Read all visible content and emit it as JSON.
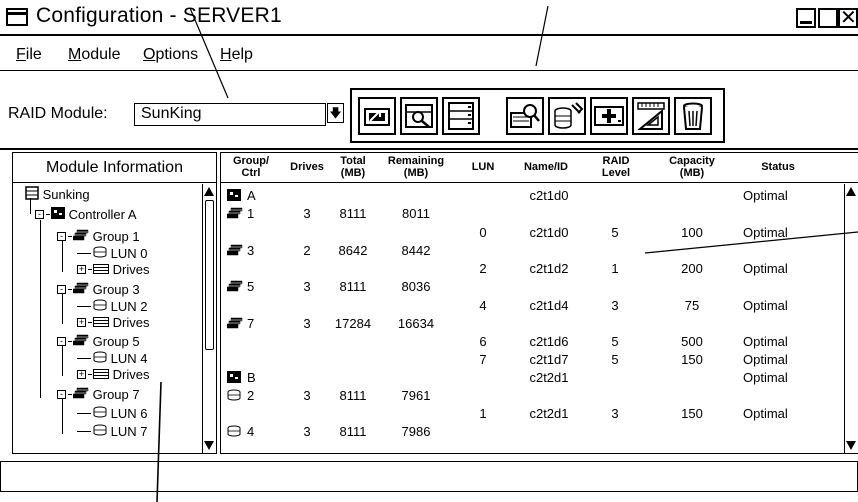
{
  "window": {
    "title": "Configuration - SERVER1"
  },
  "menu": [
    {
      "label": "File",
      "accel": "F",
      "rest": "ile"
    },
    {
      "label": "Module",
      "accel": "M",
      "rest": "odule"
    },
    {
      "label": "Options",
      "accel": "O",
      "rest": "ptions"
    },
    {
      "label": "Help",
      "accel": "H",
      "rest": "elp"
    }
  ],
  "toolbar": {
    "raid_label": "RAID Module:",
    "raid_value": "SunKing",
    "tools": [
      "create-lun-icon",
      "find-locate-icon",
      "module-profile-icon",
      "view-log-icon",
      "recovery-icon",
      "add-icon",
      "format-icon",
      "delete-trash-icon"
    ]
  },
  "left_panel": {
    "header": "Module Information",
    "tree": [
      {
        "label": "Sunking",
        "icon": "module-icon"
      },
      {
        "label": "Controller A",
        "icon": "controller-icon"
      },
      {
        "label": "Group 1",
        "icon": "group-icon"
      },
      {
        "label": "LUN 0",
        "icon": "lun-icon"
      },
      {
        "label": "Drives",
        "icon": "drives-icon"
      },
      {
        "label": "Group 3",
        "icon": "group-icon"
      },
      {
        "label": "LUN 2",
        "icon": "lun-icon"
      },
      {
        "label": "Drives",
        "icon": "drives-icon"
      },
      {
        "label": "Group 5",
        "icon": "group-icon"
      },
      {
        "label": "LUN 4",
        "icon": "lun-icon"
      },
      {
        "label": "Drives",
        "icon": "drives-icon"
      },
      {
        "label": "Group 7",
        "icon": "group-icon"
      },
      {
        "label": "LUN 6",
        "icon": "lun-icon"
      },
      {
        "label": "LUN 7",
        "icon": "lun-icon"
      }
    ]
  },
  "grid": {
    "headers": {
      "group_ctrl": [
        "Group/",
        "Ctrl"
      ],
      "drives": "Drives",
      "total": [
        "Total",
        "(MB)"
      ],
      "remaining": [
        "Remaining",
        "(MB)"
      ],
      "lun": "LUN",
      "name": "Name/ID",
      "raid": [
        "RAID",
        "Level"
      ],
      "capacity": [
        "Capacity",
        "(MB)"
      ],
      "status": "Status"
    },
    "rows": [
      {
        "icon": "controller-icon",
        "group": "A",
        "drives": "",
        "total": "",
        "remaining": "",
        "lun": "",
        "name": "c2t1d0",
        "raid": "",
        "capacity": "",
        "status": "Optimal"
      },
      {
        "icon": "group-icon",
        "group": "1",
        "drives": "3",
        "total": "8111",
        "remaining": "8011",
        "lun": "",
        "name": "",
        "raid": "",
        "capacity": "",
        "status": ""
      },
      {
        "icon": "",
        "group": "",
        "drives": "",
        "total": "",
        "remaining": "",
        "lun": "0",
        "name": "c2t1d0",
        "raid": "5",
        "capacity": "100",
        "status": "Optimal"
      },
      {
        "icon": "group-icon",
        "group": "3",
        "drives": "2",
        "total": "8642",
        "remaining": "8442",
        "lun": "",
        "name": "",
        "raid": "",
        "capacity": "",
        "status": ""
      },
      {
        "icon": "",
        "group": "",
        "drives": "",
        "total": "",
        "remaining": "",
        "lun": "2",
        "name": "c2t1d2",
        "raid": "1",
        "capacity": "200",
        "status": "Optimal"
      },
      {
        "icon": "group-icon",
        "group": "5",
        "drives": "3",
        "total": "8111",
        "remaining": "8036",
        "lun": "",
        "name": "",
        "raid": "",
        "capacity": "",
        "status": ""
      },
      {
        "icon": "",
        "group": "",
        "drives": "",
        "total": "",
        "remaining": "",
        "lun": "4",
        "name": "c2t1d4",
        "raid": "3",
        "capacity": "75",
        "status": "Optimal"
      },
      {
        "icon": "group-icon",
        "group": "7",
        "drives": "3",
        "total": "17284",
        "remaining": "16634",
        "lun": "",
        "name": "",
        "raid": "",
        "capacity": "",
        "status": ""
      },
      {
        "icon": "",
        "group": "",
        "drives": "",
        "total": "",
        "remaining": "",
        "lun": "6",
        "name": "c2t1d6",
        "raid": "5",
        "capacity": "500",
        "status": "Optimal"
      },
      {
        "icon": "",
        "group": "",
        "drives": "",
        "total": "",
        "remaining": "",
        "lun": "7",
        "name": "c2t1d7",
        "raid": "5",
        "capacity": "150",
        "status": "Optimal"
      },
      {
        "icon": "controller-icon",
        "group": "B",
        "drives": "",
        "total": "",
        "remaining": "",
        "lun": "",
        "name": "c2t2d1",
        "raid": "",
        "capacity": "",
        "status": "Optimal"
      },
      {
        "icon": "disk-icon",
        "group": "2",
        "drives": "3",
        "total": "8111",
        "remaining": "7961",
        "lun": "",
        "name": "",
        "raid": "",
        "capacity": "",
        "status": ""
      },
      {
        "icon": "",
        "group": "",
        "drives": "",
        "total": "",
        "remaining": "",
        "lun": "1",
        "name": "c2t2d1",
        "raid": "3",
        "capacity": "150",
        "status": "Optimal"
      },
      {
        "icon": "disk-icon",
        "group": "4",
        "drives": "3",
        "total": "8111",
        "remaining": "7986",
        "lun": "",
        "name": "",
        "raid": "",
        "capacity": "",
        "status": ""
      }
    ]
  },
  "statusbar": {
    "text": ""
  }
}
